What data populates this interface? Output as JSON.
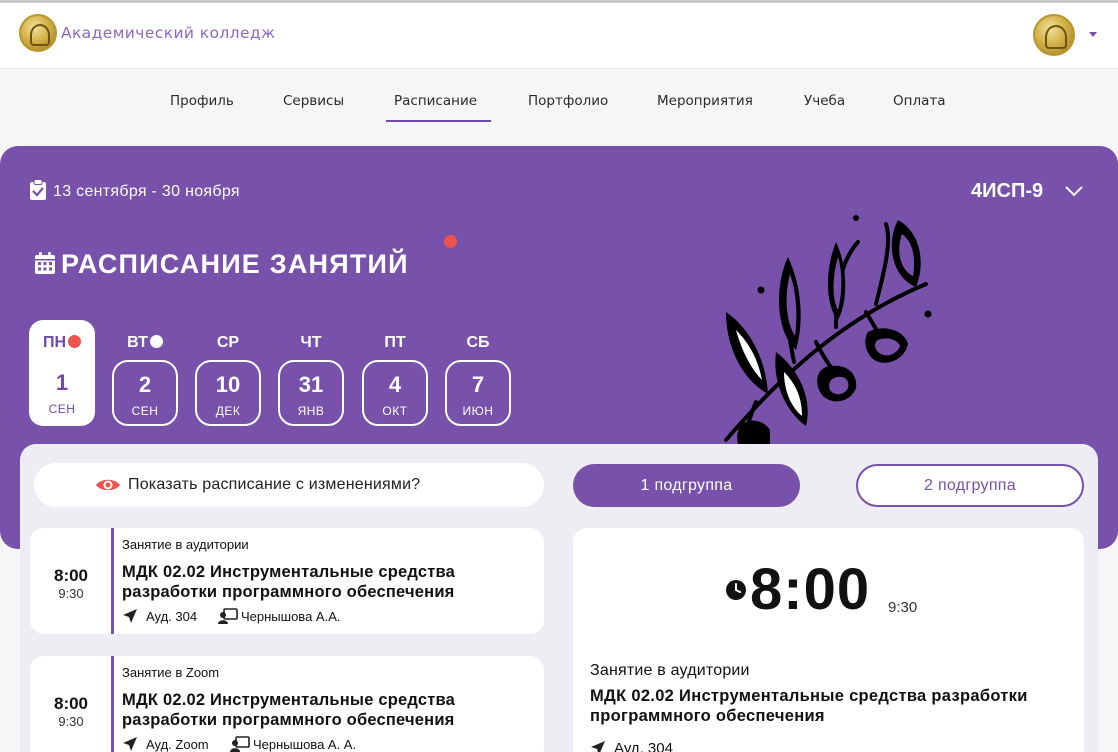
{
  "header": {
    "brand": "Академический колледж"
  },
  "nav": {
    "items": [
      "Профиль",
      "Сервисы",
      "Расписание",
      "Портфолио",
      "Мероприятия",
      "Учеба",
      "Оплата"
    ],
    "active": "Расписание"
  },
  "banner": {
    "date_range": "13 сентября - 30 ноября",
    "group": "4ИСП-9",
    "title": "РАСПИСАНИЕ ЗАНЯТИЙ"
  },
  "days": [
    {
      "name": "ПН",
      "num": "1",
      "month": "СЕН",
      "active": true,
      "dot": "red"
    },
    {
      "name": "ВТ",
      "num": "2",
      "month": "СЕН",
      "active": false,
      "dot": "white"
    },
    {
      "name": "СР",
      "num": "10",
      "month": "ДЕК",
      "active": false,
      "dot": ""
    },
    {
      "name": "ЧТ",
      "num": "31",
      "month": "ЯНВ",
      "active": false,
      "dot": ""
    },
    {
      "name": "ПТ",
      "num": "4",
      "month": "ОКТ",
      "active": false,
      "dot": ""
    },
    {
      "name": "СБ",
      "num": "7",
      "month": "ИЮН",
      "active": false,
      "dot": ""
    }
  ],
  "controls": {
    "show_changes": "Показать расписание с изменениями?",
    "subgroup1": "1 подгруппа",
    "subgroup2": "2 подгруппа"
  },
  "lessons": [
    {
      "start": "8:00",
      "end": "9:30",
      "type": "Занятие в аудитории",
      "name": "МДК 02.02 Инструментальные средства разработки программного обеспечения",
      "room": "Ауд. 304",
      "teacher": "Чернышова А.А."
    },
    {
      "start": "8:00",
      "end": "9:30",
      "type": "Занятие в Zoom",
      "name": "МДК 02.02 Инструментальные средства разработки программного обеспечения",
      "room": "Ауд. Zoom",
      "teacher": "Чернышова А. А."
    }
  ],
  "detail": {
    "start": "8:00",
    "end": "9:30",
    "type": "Занятие в аудитории",
    "name": "МДК 02.02 Инструментальные средства разработки программного обеспечения",
    "room": "Ауд. 304"
  },
  "colors": {
    "accent": "#7851aa",
    "alert": "#ef5350"
  }
}
